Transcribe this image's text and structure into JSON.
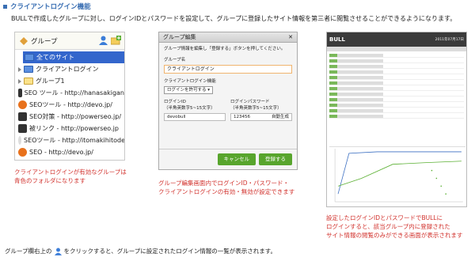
{
  "heading": "クライアントログイン機能",
  "intro": "BULLで作成したグループに対し、ログインIDとパスワードを設定して、グループに登録したサイト情報を第三者に閲覧させることができるようになります。",
  "group_panel": {
    "title": "グループ",
    "rows": [
      {
        "label": "全てのサイト",
        "icon": "blue-folder-icon"
      },
      {
        "label": "クライアントログイン",
        "icon": "folder-icon"
      },
      {
        "label": "グループ1",
        "icon": "folder-icon"
      },
      {
        "label": "SEO ツール - http://hanasakigan",
        "icon": "dark-site-icon"
      },
      {
        "label": "SEOツール - http://devo.jp/",
        "icon": "orange-site-icon"
      },
      {
        "label": "SEO対策 - http://powerseo.jp/",
        "icon": "dark-site-icon"
      },
      {
        "label": "被リンク - http://powerseo.jp",
        "icon": "dark-site-icon"
      },
      {
        "label": "SEOツール - http://itomakihitode",
        "icon": "grey-site-icon"
      },
      {
        "label": "SEO - http://devo.jp/",
        "icon": "orange-site-icon"
      }
    ]
  },
  "dialog": {
    "title": "グループ編集",
    "note": "グループ情報を編集し「登録する」ボタンを押してください。",
    "group_name_label": "グループ名",
    "group_name_value": "クライアントログイン",
    "client_login_label": "クライアントログイン機能",
    "client_login_value": "ログインを許可する",
    "login_id_label": "ログインID",
    "login_id_hint": "（半角英数字5~15文字）",
    "login_id_value": "devobull",
    "password_label": "ログインパスワード",
    "password_hint": "（半角英数字5~15文字）",
    "password_value": "123456",
    "auto_gen": "自動生成",
    "cancel_button": "キャンセル",
    "register_button": "登録する"
  },
  "mini": {
    "logo": "BULL",
    "date": "2011年07月17日"
  },
  "captions": {
    "c1": [
      "クライアントログインが有効なグループは",
      "青色のフォルダになります"
    ],
    "c2": [
      "グループ編集画面内でログインID・パスワード・",
      "クライアントログインの有効・無効が設定できます"
    ],
    "c3": [
      "設定したログインIDとパスワードでBULLに",
      "ログインすると、該当グループ内に登録された",
      "サイト情報の閲覧のみができる画面が表示されます"
    ]
  },
  "footer": {
    "before": "グループ欄右上の",
    "after": "をクリックすると、グループに設定されたログイン情報の一覧が表示されます。"
  }
}
